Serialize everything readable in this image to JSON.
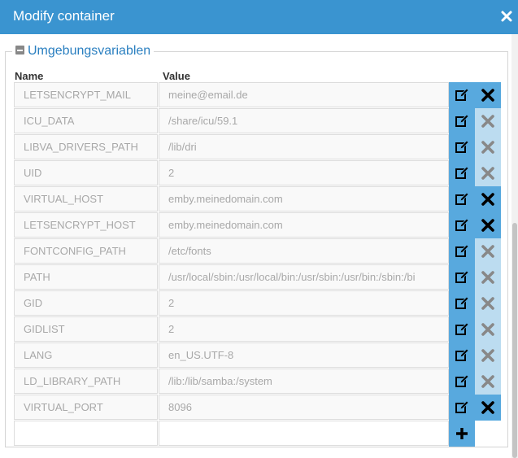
{
  "dialog": {
    "title": "Modify container",
    "close_icon": "close-icon"
  },
  "section": {
    "legend": "Umgebungsvariablen",
    "toggle_icon": "collapse-minus-icon"
  },
  "table": {
    "columns": [
      "Name",
      "Value"
    ],
    "rows": [
      {
        "name": "LETSENCRYPT_MAIL",
        "value": "meine@email.de",
        "deletable": true
      },
      {
        "name": "ICU_DATA",
        "value": "/share/icu/59.1",
        "deletable": false
      },
      {
        "name": "LIBVA_DRIVERS_PATH",
        "value": "/lib/dri",
        "deletable": false
      },
      {
        "name": "UID",
        "value": "2",
        "deletable": false
      },
      {
        "name": "VIRTUAL_HOST",
        "value": "emby.meinedomain.com",
        "deletable": true
      },
      {
        "name": "LETSENCRYPT_HOST",
        "value": "emby.meinedomain.com",
        "deletable": true
      },
      {
        "name": "FONTCONFIG_PATH",
        "value": "/etc/fonts",
        "deletable": false
      },
      {
        "name": "PATH",
        "value": "/usr/local/sbin:/usr/local/bin:/usr/sbin:/usr/bin:/sbin:/bi",
        "deletable": false
      },
      {
        "name": "GID",
        "value": "2",
        "deletable": false
      },
      {
        "name": "GIDLIST",
        "value": "2",
        "deletable": false
      },
      {
        "name": "LANG",
        "value": "en_US.UTF-8",
        "deletable": false
      },
      {
        "name": "LD_LIBRARY_PATH",
        "value": "/lib:/lib/samba:/system",
        "deletable": false
      },
      {
        "name": "VIRTUAL_PORT",
        "value": "8096",
        "deletable": true
      }
    ],
    "new_row": {
      "name": "",
      "value": ""
    }
  },
  "icons": {
    "edit": "edit-icon",
    "delete": "delete-x-icon",
    "add": "plus-icon"
  },
  "colors": {
    "titlebar": "#3a94d0",
    "button": "#58a9de",
    "button_disabled": "#bcdcf0",
    "legend": "#2a7fc0"
  }
}
